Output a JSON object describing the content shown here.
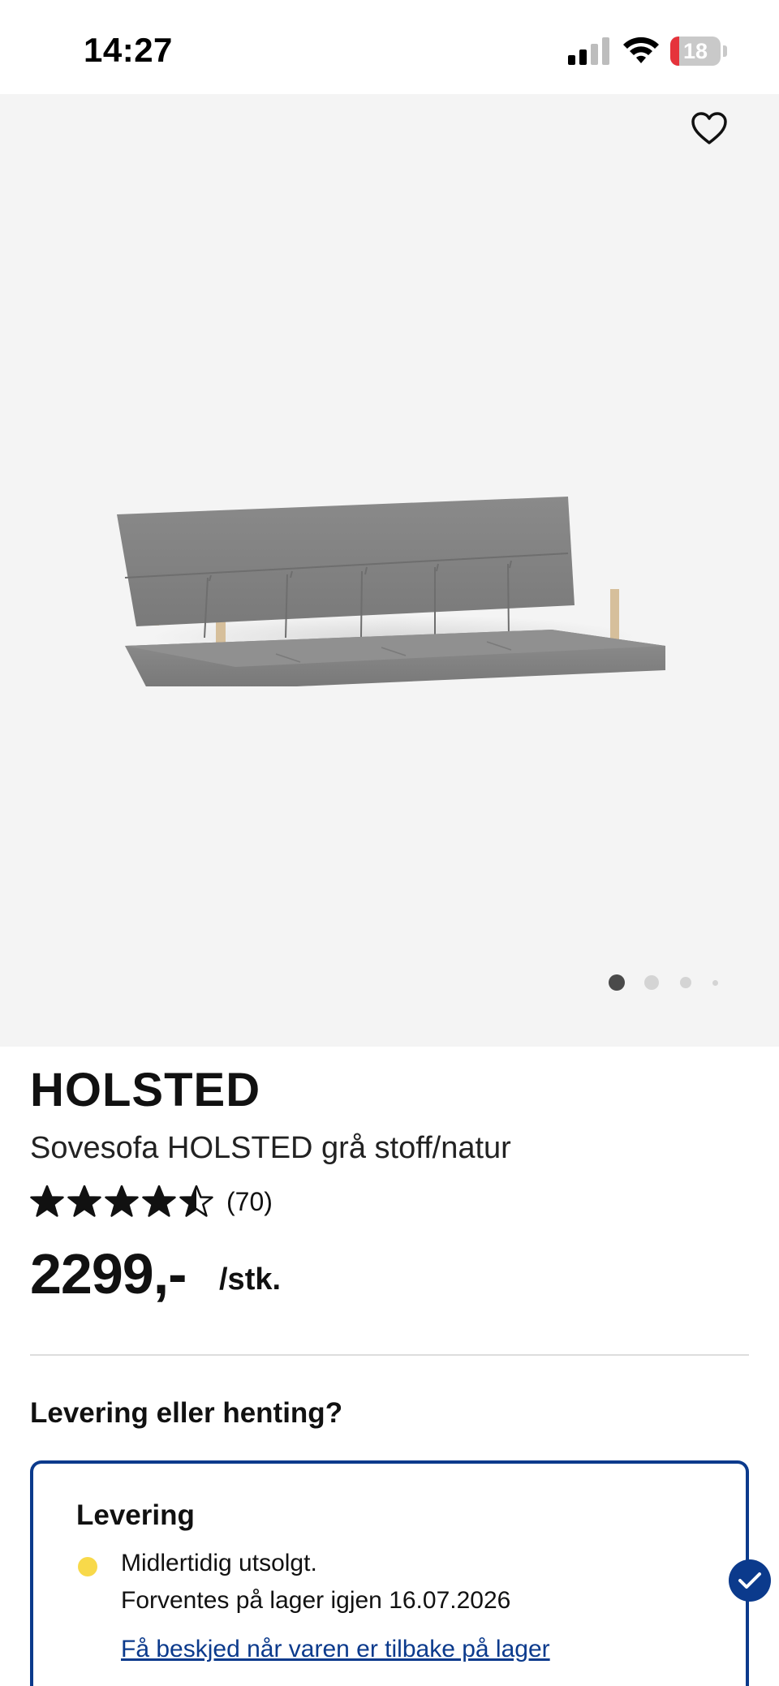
{
  "status_bar": {
    "time": "14:27",
    "battery_level": "18",
    "battery_fraction": 0.18,
    "icons": [
      "signal-icon",
      "wifi-icon",
      "battery-icon"
    ]
  },
  "gallery": {
    "favorite_icon": "heart-outline-icon",
    "image_subject": "sofa-bed-image",
    "slide_count": 4,
    "active_slide": 1
  },
  "product": {
    "name": "HOLSTED",
    "description": "Sovesofa HOLSTED grå stoff/natur",
    "rating": 4.5,
    "rating_max": 5,
    "review_count": "(70)",
    "price": "2299,-",
    "price_unit": "/stk."
  },
  "delivery_section": {
    "title": "Levering eller henting?",
    "card": {
      "title": "Levering",
      "status_color": "#f8d94a",
      "status_line1": "Midlertidig utsolgt.",
      "status_line2": "Forventes på lager igjen 16.07.2026",
      "notify_link": "Få beskjed når varen er tilbake på lager",
      "selected": true
    }
  },
  "colors": {
    "accent": "#0b3a8c",
    "gallery_bg": "#f4f4f4",
    "battery_low": "#e5333b"
  }
}
